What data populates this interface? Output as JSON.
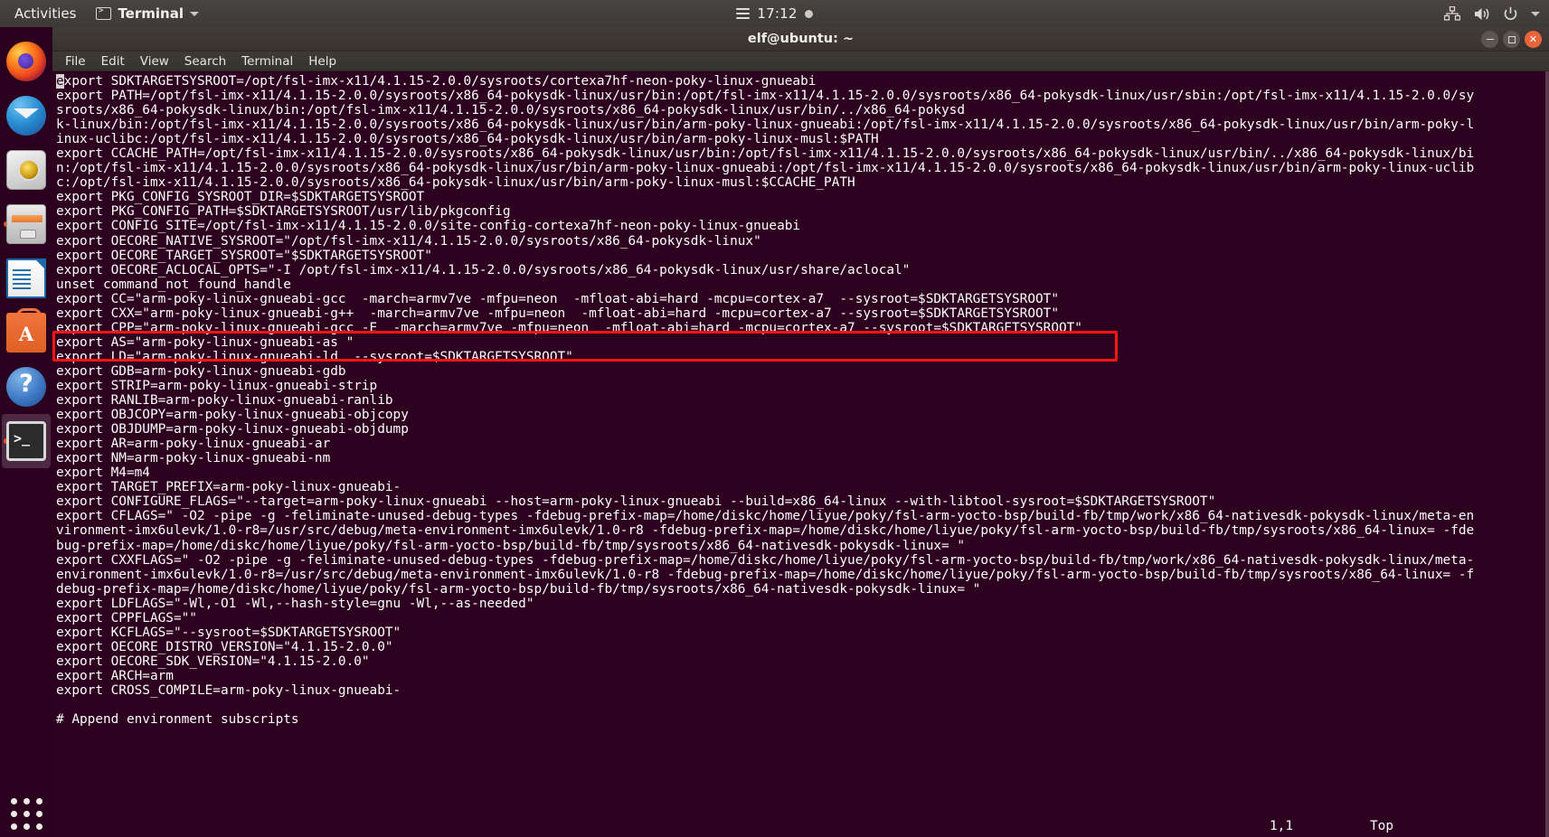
{
  "topbar": {
    "activities": "Activities",
    "app_name": "Terminal",
    "app_icon": "terminal-icon",
    "menu_icon": "hamburger-icon",
    "clock": "17:12",
    "notification_dot": "notification-indicator",
    "tray_icons": [
      "network-icon",
      "volume-icon",
      "power-icon",
      "chevron-down-icon"
    ],
    "bg_color": "#3c3936"
  },
  "dock": {
    "items": [
      {
        "name": "firefox",
        "label": "Firefox Web Browser",
        "running": false
      },
      {
        "name": "thunderbird",
        "label": "Thunderbird Mail",
        "running": false
      },
      {
        "name": "rhythmbox",
        "label": "Rhythmbox",
        "running": false
      },
      {
        "name": "files",
        "label": "Files",
        "running": true
      },
      {
        "name": "writer",
        "label": "LibreOffice Writer",
        "running": false
      },
      {
        "name": "software",
        "label": "Ubuntu Software",
        "running": false
      },
      {
        "name": "help",
        "label": "Help",
        "running": false
      },
      {
        "name": "terminal",
        "label": "Terminal",
        "running": true
      }
    ],
    "show_apps": "Show Applications"
  },
  "window": {
    "title": "elf@ubuntu: ~",
    "buttons": {
      "minimize": "minimize",
      "maximize": "maximize",
      "close": "close"
    },
    "close_color": "#e9643b"
  },
  "menubar": {
    "items": [
      "File",
      "Edit",
      "View",
      "Search",
      "Terminal",
      "Help"
    ]
  },
  "terminal": {
    "bg_color": "#2c001e",
    "fg_color": "#ffffff",
    "cursor_char": "e",
    "annotation": {
      "color": "#ff1313",
      "shape": "rectangle",
      "target_lines": [
        16,
        17
      ]
    },
    "lines": [
      "export SDKTARGETSYSROOT=/opt/fsl-imx-x11/4.1.15-2.0.0/sysroots/cortexa7hf-neon-poky-linux-gnueabi",
      "export PATH=/opt/fsl-imx-x11/4.1.15-2.0.0/sysroots/x86_64-pokysdk-linux/usr/bin:/opt/fsl-imx-x11/4.1.15-2.0.0/sysroots/x86_64-pokysdk-linux/usr/sbin:/opt/fsl-imx-x11/4.1.15-2.0.0/sy",
      "sroots/x86_64-pokysdk-linux/bin:/opt/fsl-imx-x11/4.1.15-2.0.0/sysroots/x86_64-pokysdk-linux/usr/bin/../x86_64-pokysd",
      "k-linux/bin:/opt/fsl-imx-x11/4.1.15-2.0.0/sysroots/x86_64-pokysdk-linux/usr/bin/arm-poky-linux-gnueabi:/opt/fsl-imx-x11/4.1.15-2.0.0/sysroots/x86_64-pokysdk-linux/usr/bin/arm-poky-l",
      "inux-uclibc:/opt/fsl-imx-x11/4.1.15-2.0.0/sysroots/x86_64-pokysdk-linux/usr/bin/arm-poky-linux-musl:$PATH",
      "export CCACHE_PATH=/opt/fsl-imx-x11/4.1.15-2.0.0/sysroots/x86_64-pokysdk-linux/usr/bin:/opt/fsl-imx-x11/4.1.15-2.0.0/sysroots/x86_64-pokysdk-linux/usr/bin/../x86_64-pokysdk-linux/bi",
      "n:/opt/fsl-imx-x11/4.1.15-2.0.0/sysroots/x86_64-pokysdk-linux/usr/bin/arm-poky-linux-gnueabi:/opt/fsl-imx-x11/4.1.15-2.0.0/sysroots/x86_64-pokysdk-linux/usr/bin/arm-poky-linux-uclib",
      "c:/opt/fsl-imx-x11/4.1.15-2.0.0/sysroots/x86_64-pokysdk-linux/usr/bin/arm-poky-linux-musl:$CCACHE_PATH",
      "export PKG_CONFIG_SYSROOT_DIR=$SDKTARGETSYSROOT",
      "export PKG_CONFIG_PATH=$SDKTARGETSYSROOT/usr/lib/pkgconfig",
      "export CONFIG_SITE=/opt/fsl-imx-x11/4.1.15-2.0.0/site-config-cortexa7hf-neon-poky-linux-gnueabi",
      "export OECORE_NATIVE_SYSROOT=\"/opt/fsl-imx-x11/4.1.15-2.0.0/sysroots/x86_64-pokysdk-linux\"",
      "export OECORE_TARGET_SYSROOT=\"$SDKTARGETSYSROOT\"",
      "export OECORE_ACLOCAL_OPTS=\"-I /opt/fsl-imx-x11/4.1.15-2.0.0/sysroots/x86_64-pokysdk-linux/usr/share/aclocal\"",
      "unset command_not_found_handle",
      "export CC=\"arm-poky-linux-gnueabi-gcc  -march=armv7ve -mfpu=neon  -mfloat-abi=hard -mcpu=cortex-a7  --sysroot=$SDKTARGETSYSROOT\"",
      "export CXX=\"arm-poky-linux-gnueabi-g++  -march=armv7ve -mfpu=neon  -mfloat-abi=hard -mcpu=cortex-a7 --sysroot=$SDKTARGETSYSROOT\"",
      "export CPP=\"arm-poky-linux-gnueabi-gcc -E  -march=armv7ve -mfpu=neon  -mfloat-abi=hard -mcpu=cortex-a7 --sysroot=$SDKTARGETSYSROOT\"",
      "export AS=\"arm-poky-linux-gnueabi-as \"",
      "export LD=\"arm-poky-linux-gnueabi-ld  --sysroot=$SDKTARGETSYSROOT\"",
      "export GDB=arm-poky-linux-gnueabi-gdb",
      "export STRIP=arm-poky-linux-gnueabi-strip",
      "export RANLIB=arm-poky-linux-gnueabi-ranlib",
      "export OBJCOPY=arm-poky-linux-gnueabi-objcopy",
      "export OBJDUMP=arm-poky-linux-gnueabi-objdump",
      "export AR=arm-poky-linux-gnueabi-ar",
      "export NM=arm-poky-linux-gnueabi-nm",
      "export M4=m4",
      "export TARGET_PREFIX=arm-poky-linux-gnueabi-",
      "export CONFIGURE_FLAGS=\"--target=arm-poky-linux-gnueabi --host=arm-poky-linux-gnueabi --build=x86_64-linux --with-libtool-sysroot=$SDKTARGETSYSROOT\"",
      "export CFLAGS=\" -O2 -pipe -g -feliminate-unused-debug-types -fdebug-prefix-map=/home/diskc/home/liyue/poky/fsl-arm-yocto-bsp/build-fb/tmp/work/x86_64-nativesdk-pokysdk-linux/meta-en",
      "vironment-imx6ulevk/1.0-r8=/usr/src/debug/meta-environment-imx6ulevk/1.0-r8 -fdebug-prefix-map=/home/diskc/home/liyue/poky/fsl-arm-yocto-bsp/build-fb/tmp/sysroots/x86_64-linux= -fde",
      "bug-prefix-map=/home/diskc/home/liyue/poky/fsl-arm-yocto-bsp/build-fb/tmp/sysroots/x86_64-nativesdk-pokysdk-linux= \"",
      "export CXXFLAGS=\" -O2 -pipe -g -feliminate-unused-debug-types -fdebug-prefix-map=/home/diskc/home/liyue/poky/fsl-arm-yocto-bsp/build-fb/tmp/work/x86_64-nativesdk-pokysdk-linux/meta-",
      "environment-imx6ulevk/1.0-r8=/usr/src/debug/meta-environment-imx6ulevk/1.0-r8 -fdebug-prefix-map=/home/diskc/home/liyue/poky/fsl-arm-yocto-bsp/build-fb/tmp/sysroots/x86_64-linux= -f",
      "debug-prefix-map=/home/diskc/home/liyue/poky/fsl-arm-yocto-bsp/build-fb/tmp/sysroots/x86_64-nativesdk-pokysdk-linux= \"",
      "export LDFLAGS=\"-Wl,-O1 -Wl,--hash-style=gnu -Wl,--as-needed\"",
      "export CPPFLAGS=\"\"",
      "export KCFLAGS=\"--sysroot=$SDKTARGETSYSROOT\"",
      "export OECORE_DISTRO_VERSION=\"4.1.15-2.0.0\"",
      "export OECORE_SDK_VERSION=\"4.1.15-2.0.0\"",
      "export ARCH=arm",
      "export CROSS_COMPILE=arm-poky-linux-gnueabi-",
      "",
      "# Append environment subscripts"
    ],
    "status": {
      "position": "1,1",
      "scroll": "Top"
    }
  }
}
